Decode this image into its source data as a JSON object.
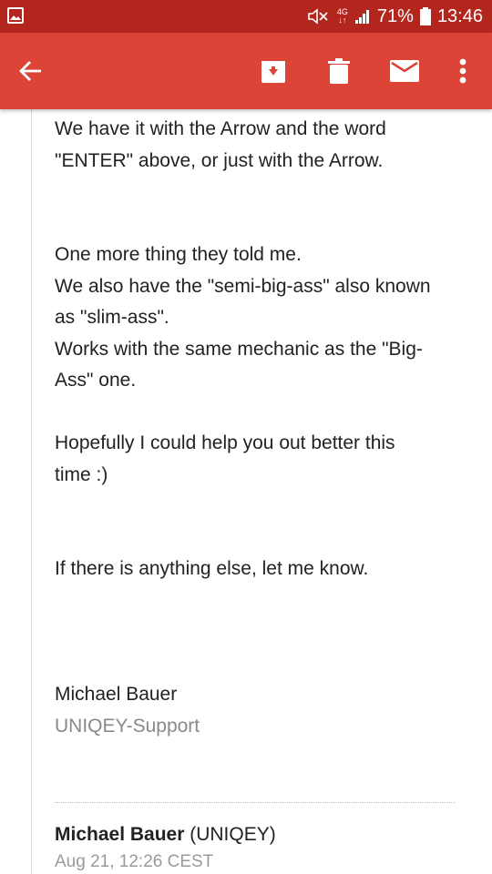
{
  "status_bar": {
    "network_small_top": "4G",
    "network_small_bottom": "↓↑",
    "battery": "71%",
    "time": "13:46",
    "left_icon": "gallery-icon",
    "icons": [
      "mute-icon",
      "signal-icon",
      "battery-icon"
    ]
  },
  "app_bar": {
    "color": "#db4437",
    "actions": [
      "back-arrow-icon",
      "archive-icon",
      "delete-icon",
      "mark-unread-icon",
      "more-vert-icon"
    ]
  },
  "email": {
    "paragraphs": [
      [
        "We have it with the Arrow and the word",
        "\"ENTER\" above, or just with the Arrow."
      ],
      [
        "One more thing they told me.",
        "We also have the \"semi-big-ass\" also known",
        "as \"slim-ass\".",
        "Works with the same mechanic as the \"Big-",
        "Ass\" one."
      ],
      [
        "Hopefully I could help you out better this",
        "time :)"
      ],
      [
        "If there is anything else, let me know."
      ]
    ],
    "signature": {
      "name": "Michael Bauer",
      "org": "UNIQEY-Support"
    }
  },
  "next_message": {
    "sender_name": "Michael Bauer",
    "sender_org": "(UNIQEY)",
    "date": "Aug 21, 12:26 CEST"
  }
}
